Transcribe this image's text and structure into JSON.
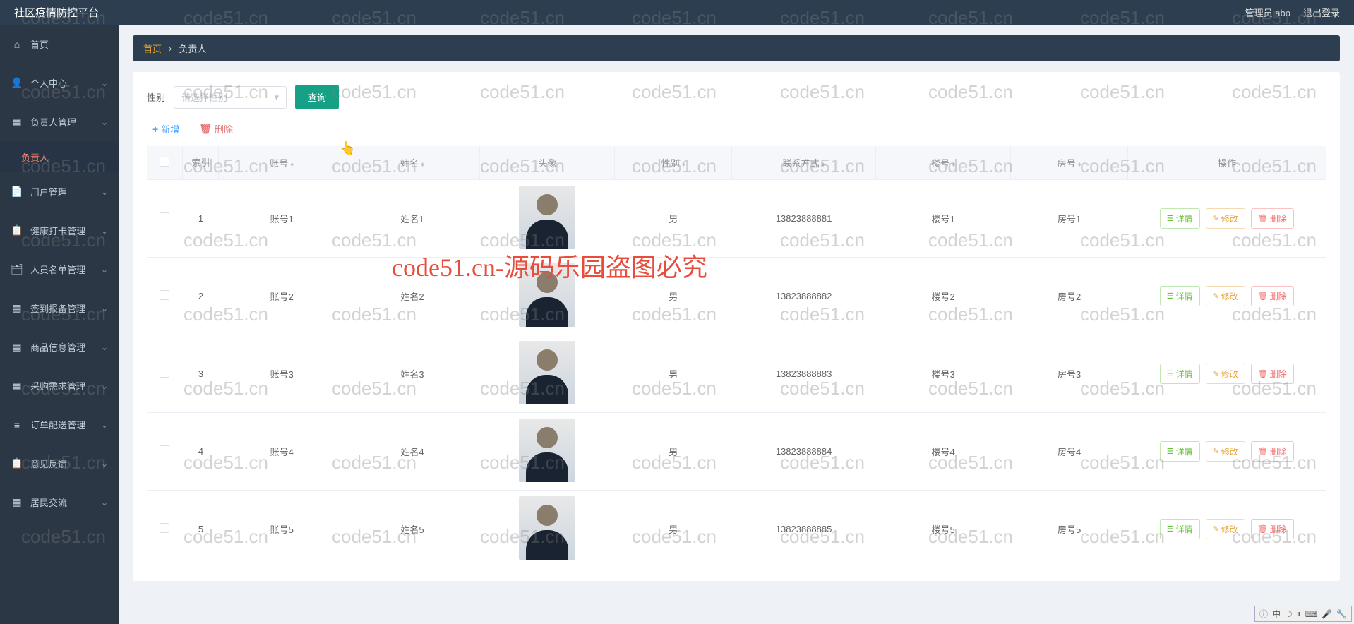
{
  "header": {
    "title": "社区疫情防控平台",
    "admin": "管理员 abo",
    "logout": "退出登录"
  },
  "sidebar": {
    "items": [
      {
        "icon": "home",
        "label": "首页"
      },
      {
        "icon": "user",
        "label": "个人中心",
        "chev": true
      },
      {
        "icon": "grid",
        "label": "负责人管理",
        "chev": true
      },
      {
        "icon": "",
        "label": "负责人",
        "sub": true
      },
      {
        "icon": "file",
        "label": "用户管理",
        "chev": true
      },
      {
        "icon": "clip",
        "label": "健康打卡管理",
        "chev": true
      },
      {
        "icon": "card",
        "label": "人员名单管理",
        "chev": true
      },
      {
        "icon": "grid",
        "label": "签到报备管理",
        "chev": true
      },
      {
        "icon": "grid",
        "label": "商品信息管理",
        "chev": true
      },
      {
        "icon": "grid",
        "label": "采购需求管理",
        "chev": true
      },
      {
        "icon": "list",
        "label": "订单配送管理",
        "chev": true
      },
      {
        "icon": "clip",
        "label": "意见反馈",
        "chev": true
      },
      {
        "icon": "grid",
        "label": "居民交流",
        "chev": true
      }
    ]
  },
  "breadcrumb": {
    "home": "首页",
    "current": "负责人"
  },
  "filter": {
    "label": "性别",
    "placeholder": "请选择性别",
    "query": "查询"
  },
  "actions": {
    "add": "新增",
    "delete": "删除"
  },
  "table": {
    "columns": {
      "idx": "索引",
      "account": "账号",
      "name": "姓名",
      "avatar": "头像",
      "sex": "性别",
      "phone": "联系方式",
      "building": "楼号",
      "room": "房号",
      "op": "操作"
    },
    "ops": {
      "detail": "详情",
      "edit": "修改",
      "delete": "删除"
    },
    "rows": [
      {
        "idx": "1",
        "account": "账号1",
        "name": "姓名1",
        "sex": "男",
        "phone": "13823888881",
        "building": "楼号1",
        "room": "房号1"
      },
      {
        "idx": "2",
        "account": "账号2",
        "name": "姓名2",
        "sex": "男",
        "phone": "13823888882",
        "building": "楼号2",
        "room": "房号2"
      },
      {
        "idx": "3",
        "account": "账号3",
        "name": "姓名3",
        "sex": "男",
        "phone": "13823888883",
        "building": "楼号3",
        "room": "房号3"
      },
      {
        "idx": "4",
        "account": "账号4",
        "name": "姓名4",
        "sex": "男",
        "phone": "13823888884",
        "building": "楼号4",
        "room": "房号4"
      },
      {
        "idx": "5",
        "account": "账号5",
        "name": "姓名5",
        "sex": "男",
        "phone": "13823888885",
        "building": "楼号5",
        "room": "房号5"
      }
    ]
  },
  "watermark": {
    "text": "code51.cn",
    "center": "code51.cn-源码乐园盗图必究"
  },
  "taskbar": {
    "ime": "中"
  },
  "icons": {
    "home": "⌂",
    "user": "👤",
    "grid": "▦",
    "file": "📄",
    "clip": "📋",
    "card": "🗂",
    "list": "≡"
  }
}
